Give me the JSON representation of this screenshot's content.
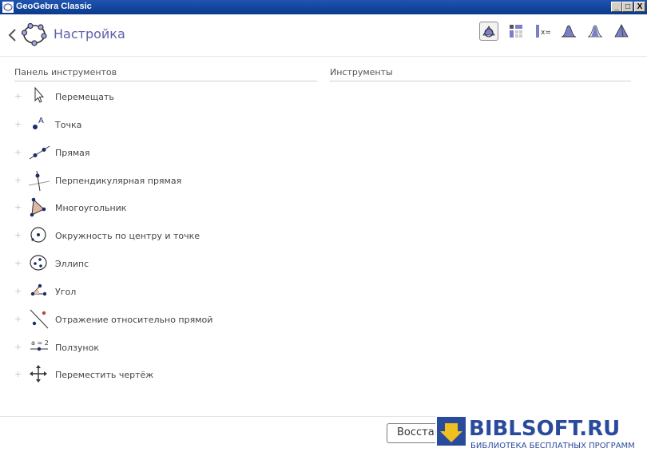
{
  "window": {
    "title": "GeoGebra Classic",
    "minimize": "_",
    "maximize": "□",
    "close": "X"
  },
  "header": {
    "title": "Настройка"
  },
  "columns": {
    "left": "Панель инструментов",
    "right": "Инструменты"
  },
  "tools": [
    {
      "label": "Перемещать",
      "icon": "cursor-arrow-icon"
    },
    {
      "label": "Точка",
      "icon": "point-icon"
    },
    {
      "label": "Прямая",
      "icon": "line-icon"
    },
    {
      "label": "Перпендикулярная прямая",
      "icon": "perpendicular-line-icon"
    },
    {
      "label": "Многоугольник",
      "icon": "polygon-icon"
    },
    {
      "label": "Окружность по центру и точке",
      "icon": "circle-center-point-icon"
    },
    {
      "label": "Эллипс",
      "icon": "ellipse-icon"
    },
    {
      "label": "Угол",
      "icon": "angle-icon"
    },
    {
      "label": "Отражение относительно прямой",
      "icon": "reflect-line-icon"
    },
    {
      "label": "Ползунок",
      "icon": "slider-icon"
    },
    {
      "label": "Переместить чертёж",
      "icon": "move-graphics-icon"
    }
  ],
  "expand_symbol": "+",
  "point_letter": "A",
  "slider_text": "a = 2",
  "footer": {
    "restore_label": "Восстановить"
  },
  "watermark": {
    "title": "BIBLSOFT.RU",
    "subtitle": "БИБЛИОТЕКА БЕСПЛАТНЫХ ПРОГРАММ"
  },
  "colors": {
    "accent": "#5b5fa8",
    "titlebar": "#1f54b0",
    "watermark": "#2a4a9c"
  }
}
